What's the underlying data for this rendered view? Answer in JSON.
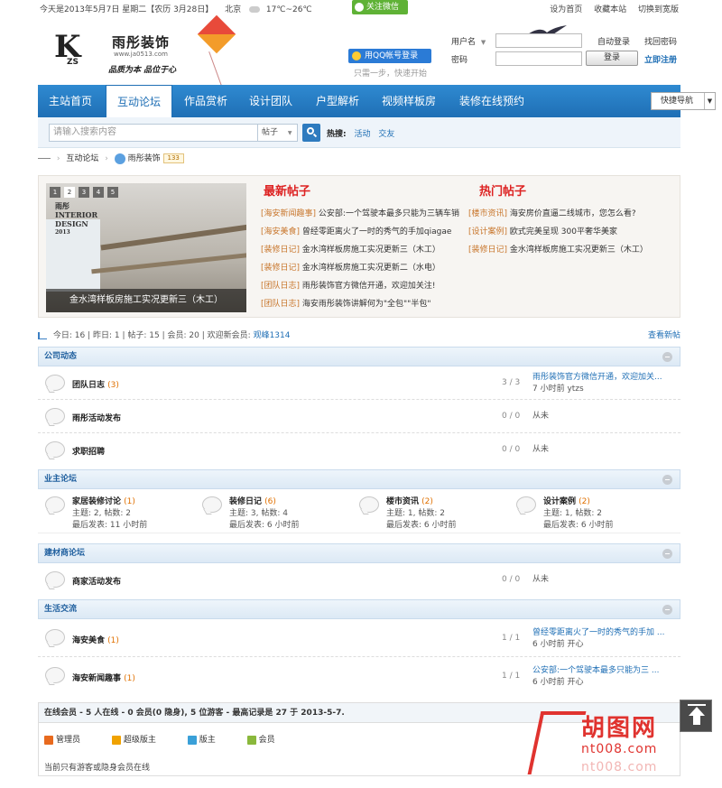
{
  "topbar": {
    "date_text": "今天是2013年5月7日 星期二【农历 3月28日】",
    "city": "北京",
    "weather": "17℃~26℃",
    "wechat_label": "关注微信",
    "links": [
      "设为首页",
      "收藏本站",
      "切换到宽版"
    ]
  },
  "logo": {
    "mark": "K",
    "zs": "ZS",
    "name": "雨彤装饰",
    "url": "www.ja0513.com",
    "slogan": "品质为本 品位于心"
  },
  "login": {
    "qq_label": "用QQ帐号登录",
    "qq_sub": "只需一步，快速开始",
    "username_label": "用户名",
    "password_label": "密码",
    "remember_label": "自动登录",
    "find_password": "找回密码",
    "register": "立即注册",
    "login_button": "登录"
  },
  "nav": {
    "items": [
      "主站首页",
      "互动论坛",
      "作品赏析",
      "设计团队",
      "户型解析",
      "视频样板房",
      "装修在线预约"
    ],
    "active_index": 1,
    "quick_nav": "快捷导航"
  },
  "search": {
    "placeholder": "请输入搜索内容",
    "type": "帖子",
    "hot_label": "热搜:",
    "hot_items": [
      "活动",
      "交友"
    ]
  },
  "breadcrumb": {
    "crumb1": "互动论坛",
    "crumb2": "雨彤装饰",
    "badge": "133"
  },
  "featured": {
    "slide_nums": [
      "1",
      "2",
      "3",
      "4",
      "5"
    ],
    "active_slide": 1,
    "slide_watermark": [
      "雨彤",
      "INTERIOR",
      "DESIGN",
      "2013"
    ],
    "slide_caption": "金水湾样板房施工实况更新三（木工）",
    "latest_title": "最新帖子",
    "hot_title": "热门帖子",
    "latest": [
      {
        "cat": "[海安新闻趣事]",
        "title": "公安部:一个驾驶本最多只能为三辆车销"
      },
      {
        "cat": "[海安美食]",
        "title": "曾经零距离火了一时的秀气的手加qiagae"
      },
      {
        "cat": "[装修日记]",
        "title": "金水湾样板房施工实况更新三（木工）"
      },
      {
        "cat": "[装修日记]",
        "title": "金水湾样板房施工实况更新二（水电）"
      },
      {
        "cat": "[团队日志]",
        "title": "雨彤装饰官方微信开通，欢迎加关注!"
      },
      {
        "cat": "[团队日志]",
        "title": "海安雨彤装饰讲解何为\"全包\"\"半包\""
      }
    ],
    "hot": [
      {
        "cat": "[楼市资讯]",
        "title": "海安房价直逼二线城市，您怎么看?"
      },
      {
        "cat": "[设计案例]",
        "title": "欧式完美呈现 300平奢华美家"
      },
      {
        "cat": "[装修日记]",
        "title": "金水湾样板房施工实况更新三（木工）"
      }
    ]
  },
  "stats": {
    "today": "今日: 16",
    "yesterday": "昨日: 1",
    "posts": "帖子: 15",
    "members": "会员: 20",
    "welcome": "欢迎新会员:",
    "new_member": "观峰1314",
    "view_new": "查看新帖"
  },
  "sections": {
    "company": {
      "title": "公司动态",
      "forums": [
        {
          "name": "团队日志",
          "count": "(3)",
          "ratio": "3 / 3",
          "last_title": "雨彤装饰官方微信开通，欢迎加关...",
          "last_meta": "7 小时前 ytzs"
        },
        {
          "name": "雨彤活动发布",
          "count": "",
          "ratio": "0 / 0",
          "last_title": "",
          "last_meta": "从未"
        },
        {
          "name": "求职招聘",
          "count": "",
          "ratio": "0 / 0",
          "last_title": "",
          "last_meta": "从未"
        }
      ]
    },
    "owner": {
      "title": "业主论坛",
      "forums": [
        {
          "name": "家居装修讨论",
          "count": "(1)",
          "line1": "主题: 2, 帖数: 2",
          "line2": "最后发表: 11 小时前"
        },
        {
          "name": "装修日记",
          "count": "(6)",
          "line1": "主题: 3, 帖数: 4",
          "line2": "最后发表: 6 小时前"
        },
        {
          "name": "楼市资讯",
          "count": "(2)",
          "line1": "主题: 1, 帖数: 2",
          "line2": "最后发表: 6 小时前"
        },
        {
          "name": "设计案例",
          "count": "(2)",
          "line1": "主题: 1, 帖数: 2",
          "line2": "最后发表: 6 小时前"
        }
      ]
    },
    "vendor": {
      "title": "建材商论坛",
      "forums": [
        {
          "name": "商家活动发布",
          "count": "",
          "ratio": "0 / 0",
          "last_title": "",
          "last_meta": "从未"
        }
      ]
    },
    "life": {
      "title": "生活交流",
      "forums": [
        {
          "name": "海安美食",
          "count": "(1)",
          "ratio": "1 / 1",
          "last_title": "曾经零距离火了一时的秀气的手加 ...",
          "last_meta": "6 小时前 开心"
        },
        {
          "name": "海安新闻趣事",
          "count": "(1)",
          "ratio": "1 / 1",
          "last_title": "公安部:一个驾驶本最多只能为三 ...",
          "last_meta": "6 小时前 开心"
        }
      ]
    }
  },
  "online": {
    "header": "在线会员 - 5 人在线 - 0 会员(0 隐身), 5 位游客 - 最高记录是 27 于 2013-5-7.",
    "legend": [
      {
        "label": "管理员",
        "color": "#e86a1e"
      },
      {
        "label": "超级版主",
        "color": "#f0a200"
      },
      {
        "label": "版主",
        "color": "#3aa0d8"
      },
      {
        "label": "会员",
        "color": "#8ab83c"
      }
    ],
    "note": "当前只有游客或隐身会员在线"
  },
  "watermark": {
    "name": "胡图网",
    "url": "nt008.com",
    "url2": "nt008.com"
  },
  "colors": {
    "nav_blue": "#1f6fb5",
    "accent_red": "#dd2222",
    "category_orange": "#c8762c"
  }
}
